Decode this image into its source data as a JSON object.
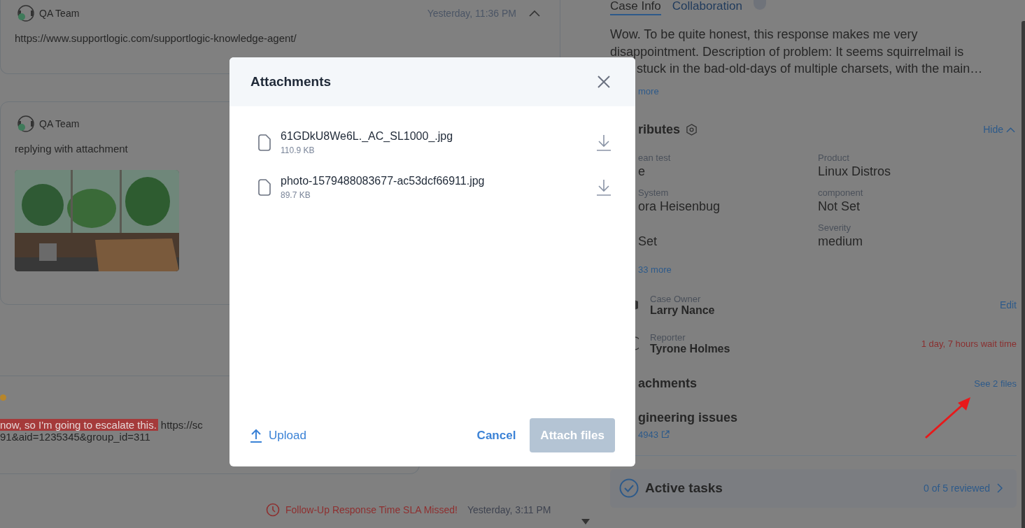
{
  "conversation": {
    "messages": [
      {
        "kind": "link",
        "author": "QA Team",
        "time": "Yesterday, 11:36 PM",
        "expanded": true,
        "text": "https://www.supportlogic.com/supportlogic-knowledge-agent/"
      },
      {
        "kind": "attachment",
        "author": "QA Team",
        "text": "replying with attachment"
      },
      {
        "kind": "escalation",
        "color": "#b8862a",
        "highlight": "now, so I'm going to escalate this.",
        "text": "https://sc",
        "text_line_2": "91&aid=1235345&group_id=311"
      }
    ],
    "sla_alert": {
      "text": "Follow-Up Response Time SLA Missed!",
      "time": "Yesterday, 3:11 PM"
    }
  },
  "case_panel": {
    "tabs": [
      {
        "label": "Case Info",
        "selected": true
      },
      {
        "label": "Collaboration",
        "selected": false
      }
    ],
    "description_lines": [
      "Wow. To be quite honest, this response makes me very",
      "disappointment. Description of problem: It seems squirrelmail is",
      "stuck in the bad-old-days of multiple charsets, with the main…"
    ],
    "show_more": "more",
    "attributes": {
      "title": "ributes",
      "hide": "Hide",
      "fields": [
        {
          "label": "ean test",
          "value": "e"
        },
        {
          "label": "System",
          "value": "ora Heisenbug"
        },
        {
          "value": "Set"
        },
        {
          "label": "Product",
          "value": "Linux Distros"
        },
        {
          "label": "component",
          "value": "Not Set"
        },
        {
          "label": "Severity",
          "value": "medium"
        }
      ],
      "more": "33 more"
    },
    "people": [
      {
        "kind": "owner",
        "role": "Case Owner",
        "name": "Larry Nance",
        "action": "Edit"
      },
      {
        "kind": "reporter",
        "role": "Reporter",
        "name": "Tyrone Holmes",
        "wait_time": "1 day, 7 hours wait time"
      }
    ],
    "attachments": {
      "title": "achments",
      "link": "See 2 files"
    },
    "engineering": {
      "title": "gineering issues",
      "link": "4943"
    },
    "active_tasks": {
      "title": "Active tasks",
      "progress": "0 of 5 reviewed"
    }
  },
  "modal": {
    "title": "Attachments",
    "files": [
      {
        "name": "61GDkU8We6L._AC_SL1000_.jpg",
        "size": "110.9 KB"
      },
      {
        "name": "photo-1579488083677-ac53dcf66911.jpg",
        "size": "89.7 KB"
      }
    ],
    "upload": "Upload",
    "cancel": "Cancel",
    "attach": {
      "label": "Attach files",
      "disabled": true
    }
  }
}
